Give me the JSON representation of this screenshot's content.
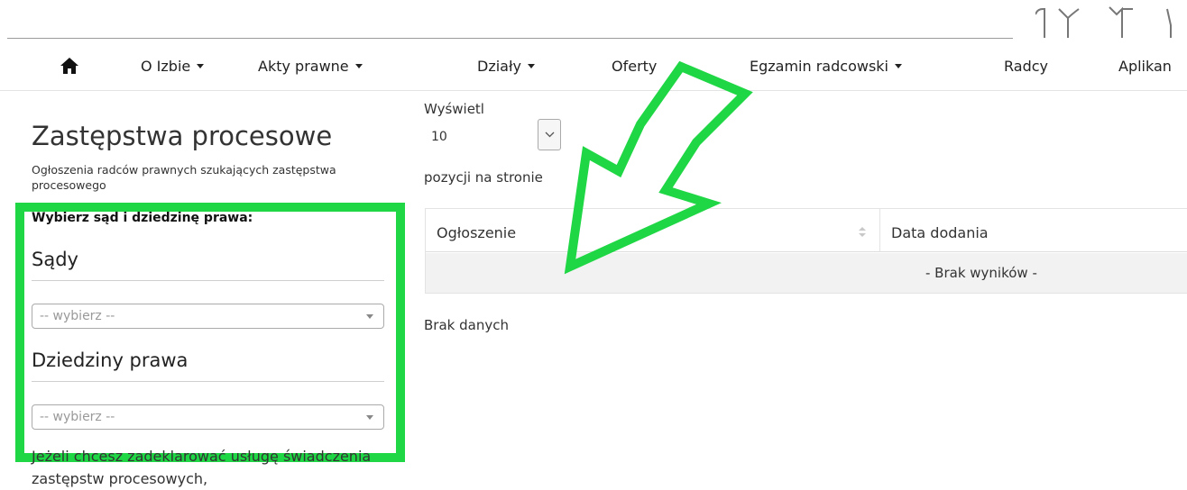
{
  "nav": {
    "items": [
      {
        "label": "O Izbie",
        "has_caret": true
      },
      {
        "label": "Akty prawne",
        "has_caret": true
      },
      {
        "label": "Działy",
        "has_caret": true
      },
      {
        "label": "Oferty",
        "has_caret": false
      },
      {
        "label": "Egzamin radcowski",
        "has_caret": true
      },
      {
        "label": "Radcy",
        "has_caret": false
      },
      {
        "label": "Aplikan",
        "has_caret": false
      }
    ],
    "home_icon": "home-icon"
  },
  "page": {
    "title": "Zastępstwa procesowe",
    "subtitle": "Ogłoszenia radców prawnych szukających zastępstwa procesowego"
  },
  "filter": {
    "heading": "Wybierz sąd i dziedzinę prawa:",
    "courts_title": "Sądy",
    "courts_placeholder": "-- wybierz --",
    "law_title": "Dziedziny prawa",
    "law_placeholder": "-- wybierz --"
  },
  "footer_text": "Jeżeli chcesz zadeklarować usługę świadczenia zastępstw procesowych,",
  "list": {
    "show_label": "Wyświetl",
    "page_size": "10",
    "per_page_label": "pozycji na stronie",
    "columns": [
      "Ogłoszenie",
      "Data dodania"
    ],
    "empty_row": "- Brak wyników -",
    "no_data": "Brak danych"
  },
  "colors": {
    "highlight": "#1fd644",
    "divider": "#e3e3e3"
  }
}
